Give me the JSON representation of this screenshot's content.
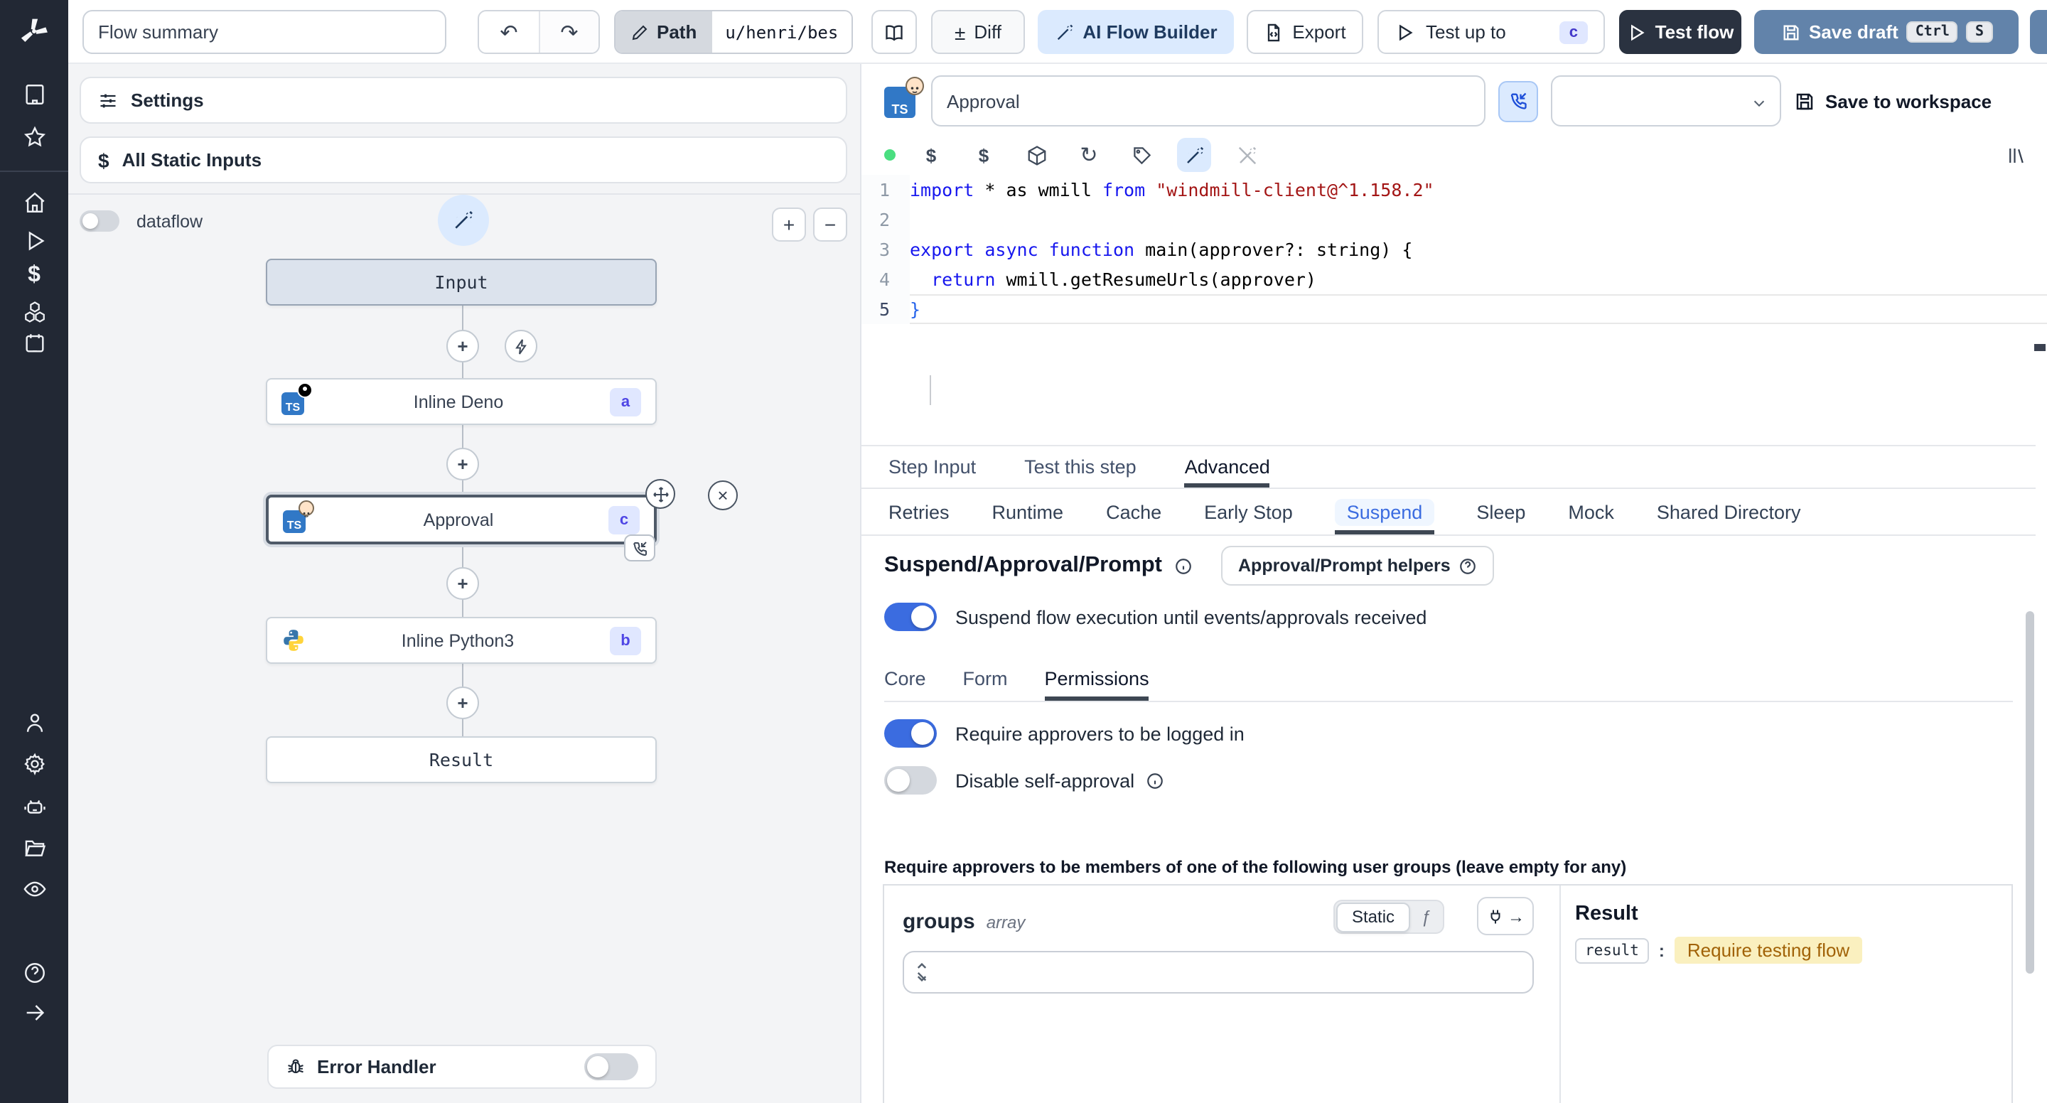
{
  "icons": {
    "ts": "TS",
    "undo": "↶",
    "redo": "↷",
    "diff": "±",
    "refresh": "↻",
    "dollar": "$",
    "fx": "ƒ",
    "arrow_right": "→",
    "close": "×",
    "plus": "+",
    "minus": "−"
  },
  "topbar": {
    "flow_summary_value": "Flow summary",
    "path_label": "Path",
    "path_value": "u/henri/bes",
    "diff_label": "Diff",
    "ai_flow_builder_label": "AI Flow Builder",
    "export_label": "Export",
    "test_up_to_label": "Test up to",
    "test_up_to_badge": "c",
    "test_flow_label": "Test flow",
    "save_draft_label": "Save draft",
    "kbd_ctrl": "Ctrl",
    "kbd_s": "S"
  },
  "left": {
    "settings_label": "Settings",
    "all_static_inputs_label": "All Static Inputs",
    "dataflow_label": "dataflow",
    "error_handler_label": "Error Handler"
  },
  "flow": {
    "input_label": "Input",
    "result_label": "Result",
    "deno": {
      "label": "Inline Deno",
      "badge": "a"
    },
    "approval": {
      "label": "Approval",
      "badge": "c"
    },
    "python": {
      "label": "Inline Python3",
      "badge": "b"
    }
  },
  "step": {
    "name_value": "Approval",
    "save_to_workspace_label": "Save to workspace"
  },
  "code": {
    "lines": [
      {
        "n": "1",
        "tokens": [
          [
            "kw",
            "import"
          ],
          [
            "pl",
            " * as wmill "
          ],
          [
            "kw",
            "from"
          ],
          [
            "str",
            " \"windmill-client@^1.158.2\""
          ]
        ]
      },
      {
        "n": "2",
        "tokens": []
      },
      {
        "n": "3",
        "tokens": [
          [
            "kw",
            "export async function"
          ],
          [
            "pl",
            " main(approver?: string) {"
          ]
        ]
      },
      {
        "n": "4",
        "tokens": [
          [
            "pl",
            "  "
          ],
          [
            "kw",
            "return"
          ],
          [
            "pl",
            " wmill.getResumeUrls(approver)"
          ]
        ]
      },
      {
        "n": "5",
        "tokens": [
          [
            "blu",
            "}"
          ]
        ]
      }
    ]
  },
  "tabs": {
    "main": [
      "Step Input",
      "Test this step",
      "Advanced"
    ],
    "advanced": [
      "Retries",
      "Runtime",
      "Cache",
      "Early Stop",
      "Suspend",
      "Sleep",
      "Mock",
      "Shared Directory"
    ],
    "suspend_inner": [
      "Core",
      "Form",
      "Permissions"
    ]
  },
  "suspend": {
    "title": "Suspend/Approval/Prompt",
    "helpers_label": "Approval/Prompt helpers",
    "suspend_toggle_label": "Suspend flow execution until events/approvals received",
    "require_login_label": "Require approvers to be logged in",
    "disable_self_label": "Disable self-approval",
    "groups_heading": "Require approvers to be members of one of the following user groups (leave empty for any)",
    "groups_name": "groups",
    "groups_type": "array",
    "static_label": "Static",
    "result_title": "Result",
    "result_key": "result",
    "result_colon": ":",
    "result_value": "Require testing flow"
  },
  "colors": {
    "accent": "#3b6ce0",
    "badge_bg": "#e0e7ff",
    "badge_text": "#4f46e5",
    "save_draft_bg": "#6283aa",
    "test_flow_bg": "#2a3240",
    "result_value_bg": "#faf0bf",
    "result_value_text": "#a16207"
  }
}
